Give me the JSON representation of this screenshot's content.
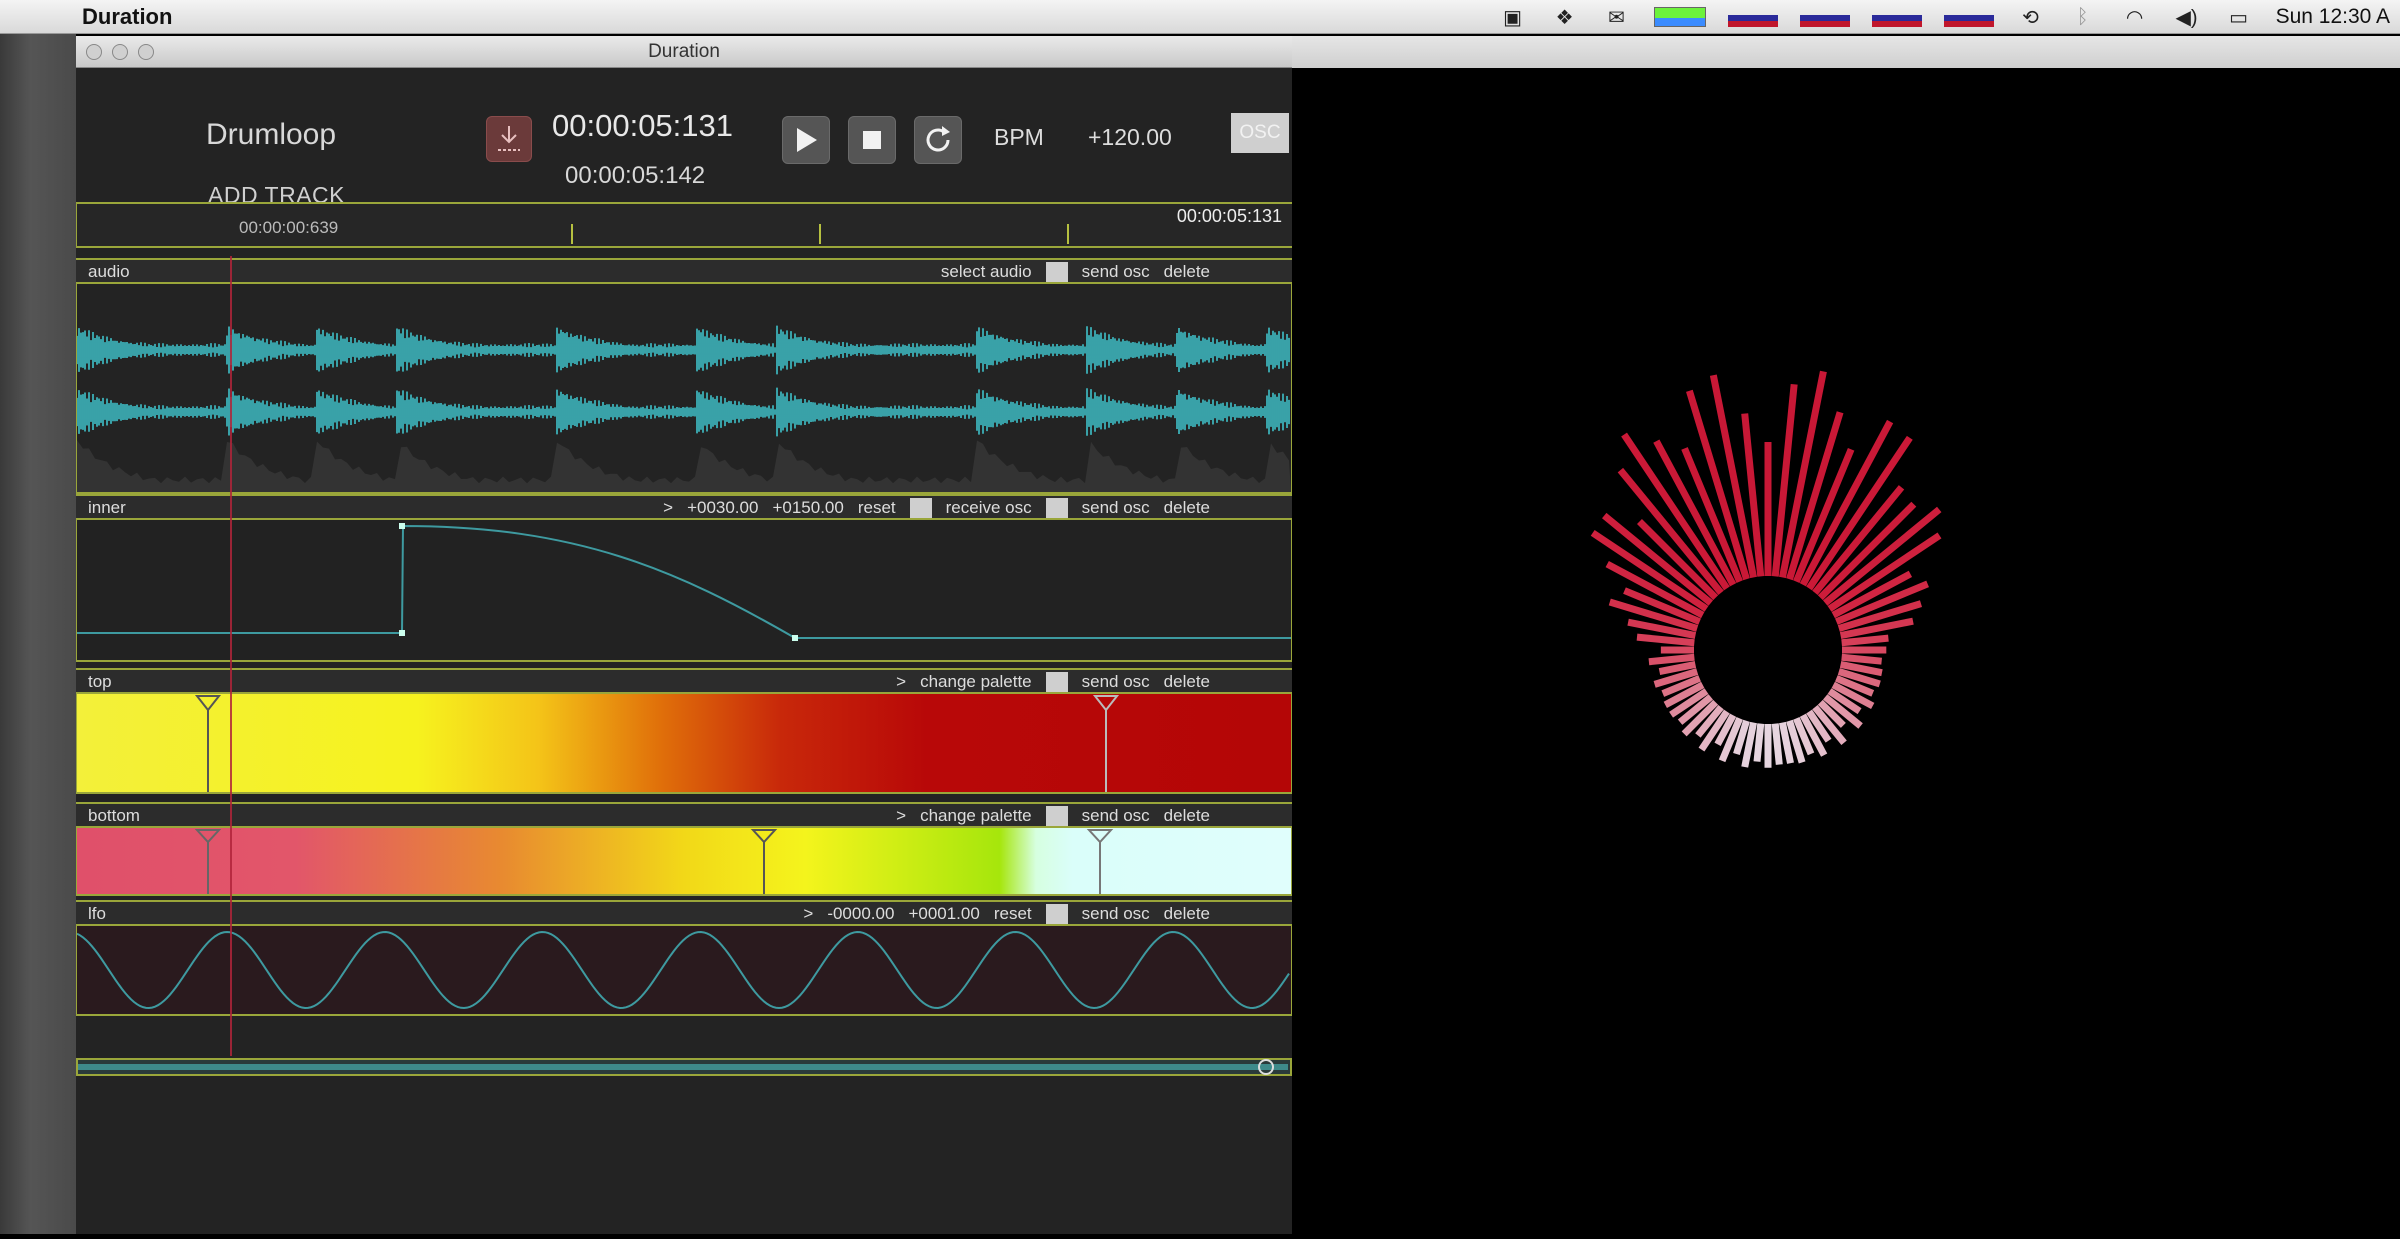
{
  "menubar": {
    "app_name": "Duration",
    "clock": "Sun 12:30 A"
  },
  "window": {
    "title": "Duration"
  },
  "header": {
    "doc_name": "Drumloop",
    "add_track": "ADD TRACK",
    "time_main": "00:00:05:131",
    "time_sub": "00:00:05:142",
    "bpm_label": "BPM",
    "bpm_value": "+120.00",
    "osc_label": "OSC"
  },
  "ruler": {
    "playhead_time": "00:00:00:639",
    "end_time": "00:00:05:131"
  },
  "tracks": {
    "audio": {
      "name": "audio",
      "select_audio": "select audio",
      "send_osc": "send osc",
      "delete": "delete"
    },
    "inner": {
      "name": "inner",
      "arrow": ">",
      "min": "+0030.00",
      "max": "+0150.00",
      "reset": "reset",
      "receive_osc": "receive osc",
      "send_osc": "send osc",
      "delete": "delete"
    },
    "top": {
      "name": "top",
      "arrow": ">",
      "change_palette": "change palette",
      "send_osc": "send osc",
      "delete": "delete"
    },
    "bottom": {
      "name": "bottom",
      "arrow": ">",
      "change_palette": "change palette",
      "send_osc": "send osc",
      "delete": "delete"
    },
    "lfo": {
      "name": "lfo",
      "arrow": ">",
      "min": "-0000.00",
      "max": "+0001.00",
      "reset": "reset",
      "send_osc": "send osc",
      "delete": "delete"
    }
  },
  "colors": {
    "accent_border": "#9aa63a",
    "waveform": "#3fc1c9",
    "curve": "#3e9aa0",
    "playhead": "#b0243a"
  }
}
